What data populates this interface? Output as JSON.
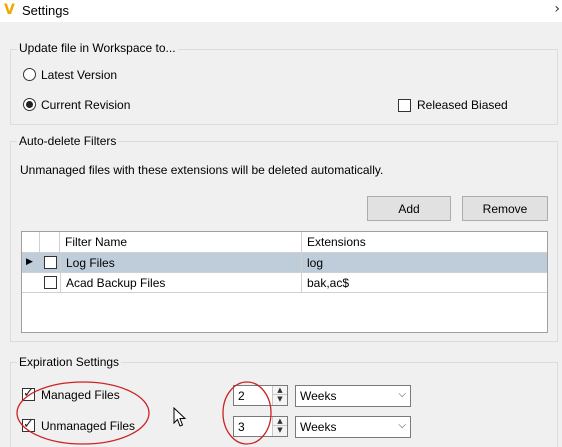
{
  "window": {
    "title": "Settings"
  },
  "icons": {
    "app": "vault-logo-icon",
    "chevron": "chevron-right-icon",
    "row_pointer": "row-pointer-icon",
    "spin_up": "spin-up-icon",
    "spin_down": "spin-down-icon",
    "dropdown": "chevron-down-icon",
    "cursor": "mouse-pointer-icon"
  },
  "update_group": {
    "label": "Update file in Workspace to...",
    "latest_version_label": "Latest Version",
    "current_revision_label": "Current Revision",
    "released_biased_label": "Released Biased",
    "selected": "Current Revision",
    "released_biased_checked": false
  },
  "autodelete_group": {
    "label": "Auto-delete Filters",
    "description": "Unmanaged files with these extensions will be deleted automatically.",
    "add_label": "Add",
    "remove_label": "Remove",
    "columns": [
      "Filter Name",
      "Extensions"
    ],
    "rows": [
      {
        "name": "Log Files",
        "extensions": "log",
        "checked": false,
        "selected": true
      },
      {
        "name": "Acad Backup Files",
        "extensions": "bak,ac$",
        "checked": false,
        "selected": false
      }
    ]
  },
  "expiration_group": {
    "label": "Expiration Settings",
    "managed_label": "Managed Files",
    "unmanaged_label": "Unmanaged Files",
    "managed_checked": true,
    "unmanaged_checked": true,
    "managed_value": "2",
    "unmanaged_value": "3",
    "managed_unit": "Weeks",
    "unmanaged_unit": "Weeks"
  },
  "colors": {
    "selected_row": "#bfcddb",
    "annotation": "#cc2222",
    "app_icon": "#f0a800"
  }
}
